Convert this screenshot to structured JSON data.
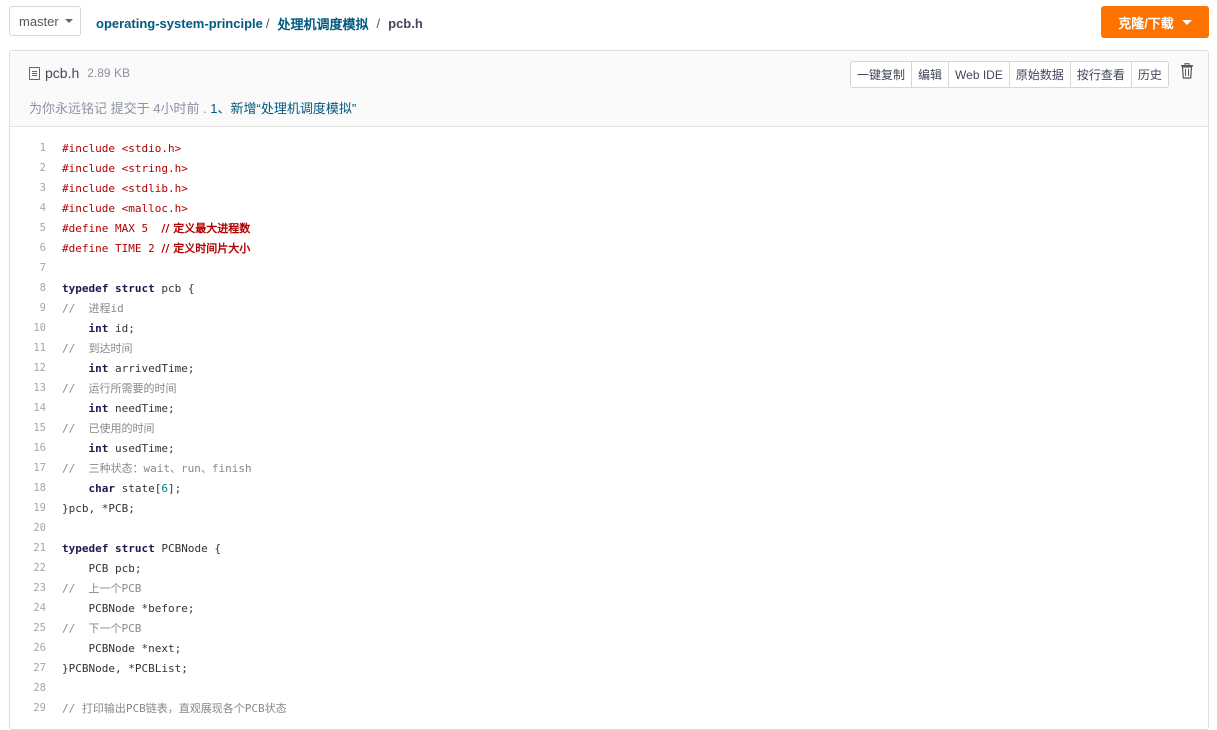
{
  "branch": {
    "label": "master"
  },
  "breadcrumb": {
    "repo": "operating-system-principle",
    "sep1": "/",
    "folder": "处理机调度模拟",
    "sep2": "/",
    "file": "pcb.h"
  },
  "clone_button": {
    "label": "克隆/下载"
  },
  "file": {
    "name": "pcb.h",
    "size": "2.89 KB",
    "commit": {
      "prefix": "为你永远铭记 提交于 4小时前 . ",
      "message": "1、新增“处理机调度模拟”"
    },
    "actions": [
      "一键复制",
      "编辑",
      "Web IDE",
      "原始数据",
      "按行查看",
      "历史"
    ]
  },
  "colors": {
    "accent": "#fe7300",
    "link": "#005980",
    "preprocessor": "#b30000"
  },
  "code_lines": [
    {
      "n": "1",
      "t": "#include <stdio.h>",
      "k": "pp"
    },
    {
      "n": "2",
      "t": "#include <string.h>",
      "k": "pp"
    },
    {
      "n": "3",
      "t": "#include <stdlib.h>",
      "k": "pp"
    },
    {
      "n": "4",
      "t": "#include <malloc.h>",
      "k": "pp"
    },
    {
      "n": "5",
      "t": "#define MAX 5  // 定义最大进程数",
      "k": "pp"
    },
    {
      "n": "6",
      "t": "#define TIME 2 // 定义时间片大小",
      "k": "pp"
    },
    {
      "n": "7",
      "t": "",
      "k": "src"
    },
    {
      "n": "8",
      "t": "typedef struct pcb {",
      "k": "kwline"
    },
    {
      "n": "9",
      "t": "//  进程id",
      "k": "cm"
    },
    {
      "n": "10",
      "t": "    int id;",
      "k": "decl"
    },
    {
      "n": "11",
      "t": "//  到达时间",
      "k": "cm"
    },
    {
      "n": "12",
      "t": "    int arrivedTime;",
      "k": "decl"
    },
    {
      "n": "13",
      "t": "//  运行所需要的时间",
      "k": "cm"
    },
    {
      "n": "14",
      "t": "    int needTime;",
      "k": "decl"
    },
    {
      "n": "15",
      "t": "//  已使用的时间",
      "k": "cm"
    },
    {
      "n": "16",
      "t": "    int usedTime;",
      "k": "decl"
    },
    {
      "n": "17",
      "t": "//  三种状态：wait、run、finish",
      "k": "cm"
    },
    {
      "n": "18",
      "t": "    char state[6];",
      "k": "decl"
    },
    {
      "n": "19",
      "t": "}pcb, *PCB;",
      "k": "src"
    },
    {
      "n": "20",
      "t": "",
      "k": "src"
    },
    {
      "n": "21",
      "t": "typedef struct PCBNode {",
      "k": "kwline"
    },
    {
      "n": "22",
      "t": "    PCB pcb;",
      "k": "src"
    },
    {
      "n": "23",
      "t": "//  上一个PCB",
      "k": "cm"
    },
    {
      "n": "24",
      "t": "    PCBNode *before;",
      "k": "src"
    },
    {
      "n": "25",
      "t": "//  下一个PCB",
      "k": "cm"
    },
    {
      "n": "26",
      "t": "    PCBNode *next;",
      "k": "src"
    },
    {
      "n": "27",
      "t": "}PCBNode, *PCBList;",
      "k": "src"
    },
    {
      "n": "28",
      "t": "",
      "k": "src"
    },
    {
      "n": "29",
      "t": "// 打印输出PCB链表，直观展现各个PCB状态",
      "k": "cm"
    }
  ]
}
